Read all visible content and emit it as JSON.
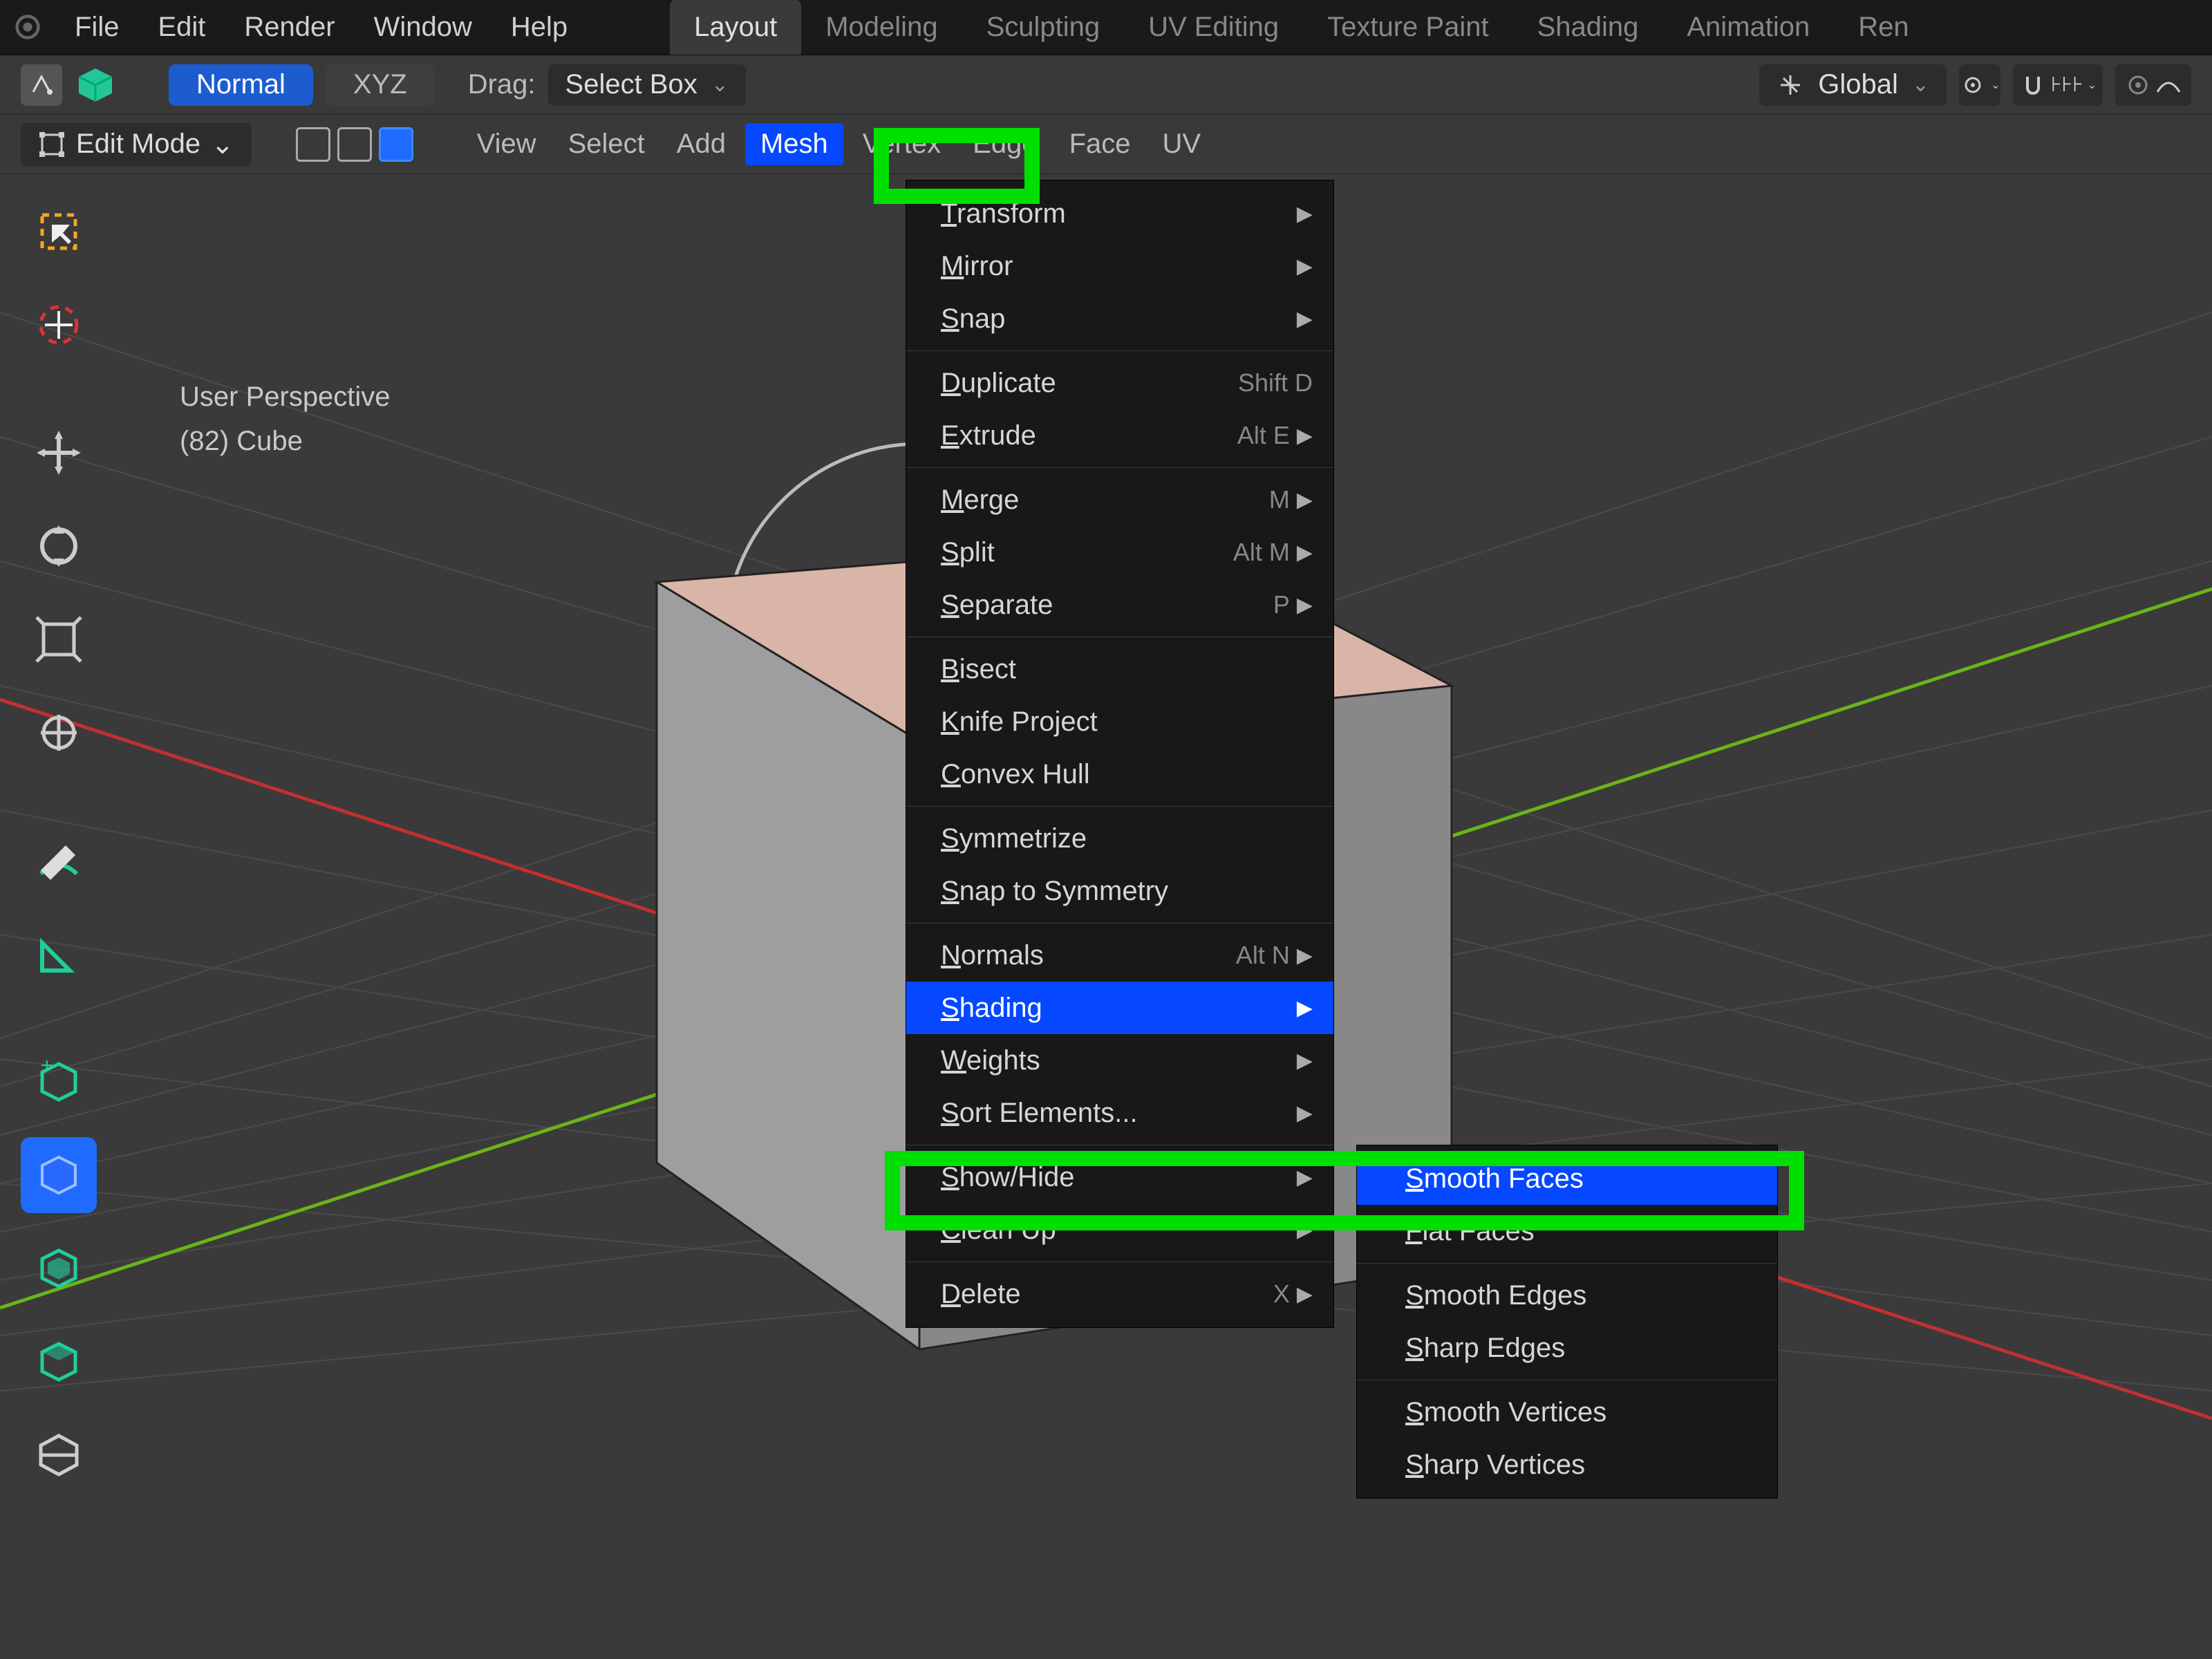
{
  "topbar": {
    "menus": [
      "File",
      "Edit",
      "Render",
      "Window",
      "Help"
    ],
    "tabs": [
      "Layout",
      "Modeling",
      "Sculpting",
      "UV Editing",
      "Texture Paint",
      "Shading",
      "Animation",
      "Ren"
    ],
    "active_tab": 0
  },
  "bar2": {
    "shading_label_normal": "Normal",
    "shading_label_xyz": "XYZ",
    "drag_label": "Drag:",
    "drag_value": "Select Box",
    "orient_value": "Global"
  },
  "bar3": {
    "mode": "Edit Mode",
    "menus": [
      "View",
      "Select",
      "Add",
      "Mesh",
      "Vertex",
      "Edge",
      "Face",
      "UV"
    ],
    "active_menu": 3
  },
  "viewport": {
    "perspective": "User Perspective",
    "object": "(82) Cube"
  },
  "mesh_menu": [
    {
      "label": "Transform",
      "sub": true
    },
    {
      "label": "Mirror",
      "sub": true
    },
    {
      "label": "Snap",
      "sub": true
    },
    {
      "sep": true
    },
    {
      "label": "Duplicate",
      "kb": "Shift D"
    },
    {
      "label": "Extrude",
      "kb": "Alt E",
      "sub": true
    },
    {
      "sep": true
    },
    {
      "label": "Merge",
      "kb": "M",
      "sub": true
    },
    {
      "label": "Split",
      "kb": "Alt M",
      "sub": true
    },
    {
      "label": "Separate",
      "kb": "P",
      "sub": true
    },
    {
      "sep": true
    },
    {
      "label": "Bisect"
    },
    {
      "label": "Knife Project"
    },
    {
      "label": "Convex Hull"
    },
    {
      "sep": true
    },
    {
      "label": "Symmetrize"
    },
    {
      "label": "Snap to Symmetry"
    },
    {
      "sep": true
    },
    {
      "label": "Normals",
      "kb": "Alt N",
      "sub": true
    },
    {
      "label": "Shading",
      "sub": true,
      "hl": true
    },
    {
      "label": "Weights",
      "sub": true
    },
    {
      "label": "Sort Elements...",
      "sub": true
    },
    {
      "sep": true
    },
    {
      "label": "Show/Hide",
      "sub": true
    },
    {
      "label": "Clean Up",
      "sub": true
    },
    {
      "sep": true
    },
    {
      "label": "Delete",
      "kb": "X",
      "sub": true
    }
  ],
  "shading_submenu": [
    {
      "label": "Smooth Faces",
      "hl": true
    },
    {
      "label": "Flat Faces"
    },
    {
      "sep": true
    },
    {
      "label": "Smooth Edges"
    },
    {
      "label": "Sharp Edges"
    },
    {
      "sep": true
    },
    {
      "label": "Smooth Vertices"
    },
    {
      "label": "Sharp Vertices"
    }
  ],
  "tool_names": [
    "select-box",
    "cursor",
    "move",
    "rotate",
    "scale",
    "transform",
    "annotate",
    "measure",
    "add-cube",
    "extrude",
    "inset",
    "bevel",
    "loop-cut"
  ]
}
